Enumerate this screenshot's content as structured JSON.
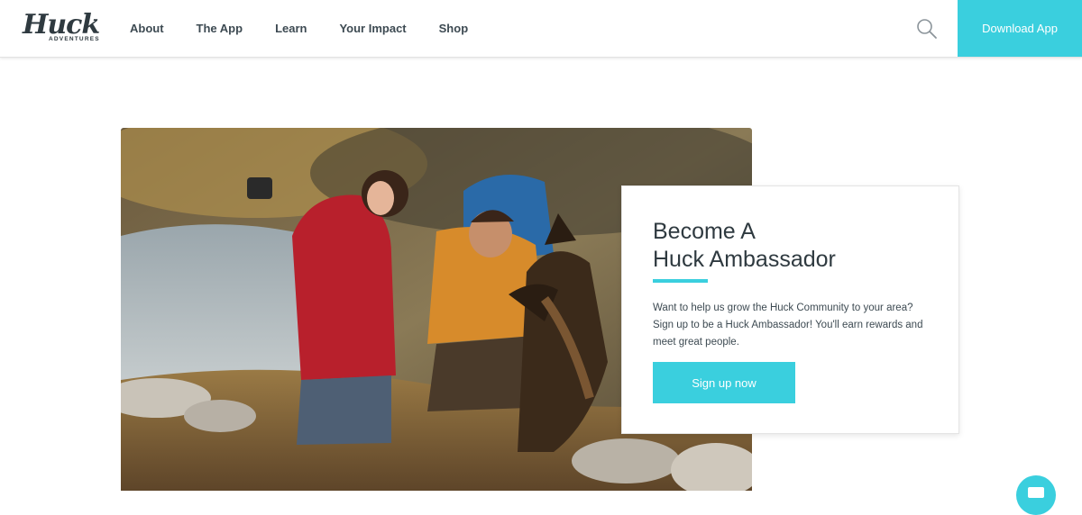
{
  "header": {
    "logo": {
      "main": "Huck",
      "sub": "ADVENTURES"
    },
    "nav": [
      {
        "label": "About"
      },
      {
        "label": "The App"
      },
      {
        "label": "Learn"
      },
      {
        "label": "Your Impact"
      },
      {
        "label": "Shop"
      }
    ],
    "search_icon": "search-icon",
    "download_label": "Download App"
  },
  "hero": {
    "image_icon": "hiker-selfie-photo"
  },
  "card": {
    "title_line1": "Become A",
    "title_line2": "Huck Ambassador",
    "text_line1": "Want to help us grow the Huck Community to your area?",
    "text_line2": "Sign up to be a Huck Ambassador! You'll earn rewards and",
    "text_line3": "meet great people.",
    "button_label": "Sign up now"
  },
  "chat": {
    "icon": "chat-icon"
  },
  "colors": {
    "accent": "#3acfde",
    "text_dark": "#2f3a40"
  }
}
